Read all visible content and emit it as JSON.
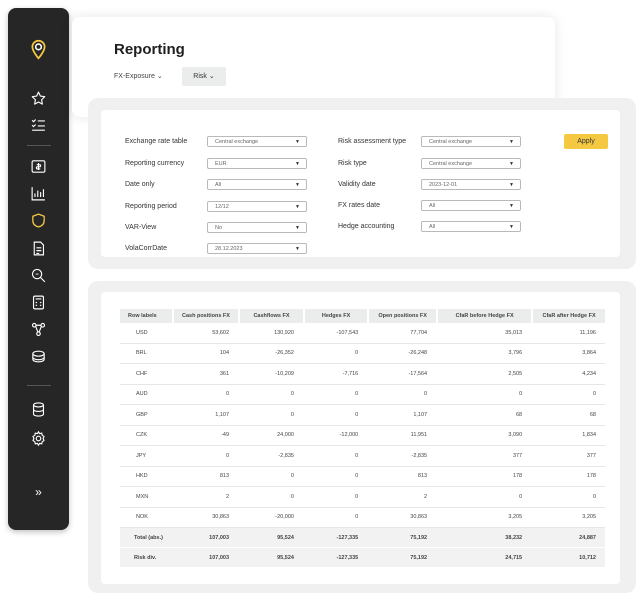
{
  "header": {
    "title": "Reporting",
    "tabs": [
      {
        "label": "FX-Exposure"
      },
      {
        "label": "Risk"
      }
    ]
  },
  "sidebar": {
    "icons": [
      "logo-pin-icon",
      "star-icon",
      "checklist-icon",
      "currency-icon",
      "bar-chart-icon",
      "shield-icon",
      "document-icon",
      "search-icon",
      "calculator-icon",
      "network-icon",
      "coins-icon",
      "database-icon",
      "settings-icon",
      "expand-icon"
    ],
    "active_color": "#f5c842",
    "expand_label": "»"
  },
  "filters": {
    "left": [
      {
        "label": "Exchange rate table",
        "value": "Central exchange"
      },
      {
        "label": "Reporting currency",
        "value": "EUR"
      },
      {
        "label": "Date only",
        "value": "All"
      },
      {
        "label": "Reporting period",
        "value": "12/12"
      },
      {
        "label": "VAR-View",
        "value": "No"
      },
      {
        "label": "VolaCorrDate",
        "value": "28.12.2023"
      }
    ],
    "right": [
      {
        "label": "Risk assessment type",
        "value": "Central exchange"
      },
      {
        "label": "Risk type",
        "value": "Central exchange"
      },
      {
        "label": "Validity date",
        "value": "2023-12-01"
      },
      {
        "label": "FX rates date",
        "value": "All"
      },
      {
        "label": "Hedge accounting",
        "value": "All"
      }
    ],
    "apply_label": "Apply",
    "accent": "#f5c842"
  },
  "table": {
    "headers": [
      "Row labels",
      "Cash positions FX",
      "Cashflows FX",
      "Hedges FX",
      "Open positions FX",
      "CfaR before Hedge FX",
      "CfaR after Hedge FX"
    ],
    "rows": [
      [
        "USD",
        "53,602",
        "130,920",
        "-107,543",
        "77,704",
        "35,013",
        "11,196"
      ],
      [
        "BRL",
        "104",
        "-26,352",
        "0",
        "-26,248",
        "3,796",
        "3,864"
      ],
      [
        "CHF",
        "361",
        "-10,209",
        "-7,716",
        "-17,564",
        "2,505",
        "4,234"
      ],
      [
        "AUD",
        "0",
        "0",
        "0",
        "0",
        "0",
        "0"
      ],
      [
        "GBP",
        "1,107",
        "0",
        "0",
        "1,107",
        "68",
        "68"
      ],
      [
        "CZK",
        "-49",
        "24,000",
        "-12,000",
        "11,951",
        "3,090",
        "1,834"
      ],
      [
        "JPY",
        "0",
        "-2,835",
        "0",
        "-2,835",
        "377",
        "377"
      ],
      [
        "HKD",
        "813",
        "0",
        "0",
        "813",
        "178",
        "178"
      ],
      [
        "MXN",
        "2",
        "0",
        "0",
        "2",
        "0",
        "0"
      ],
      [
        "NOK",
        "30,863",
        "-20,000",
        "0",
        "30,863",
        "3,205",
        "3,205"
      ]
    ],
    "summary": [
      [
        "Total (abs.)",
        "107,003",
        "95,524",
        "-127,335",
        "75,192",
        "38,232",
        "24,887"
      ],
      [
        "Risk div.",
        "107,003",
        "95,524",
        "-127,335",
        "75,192",
        "24,715",
        "10,712"
      ]
    ]
  }
}
